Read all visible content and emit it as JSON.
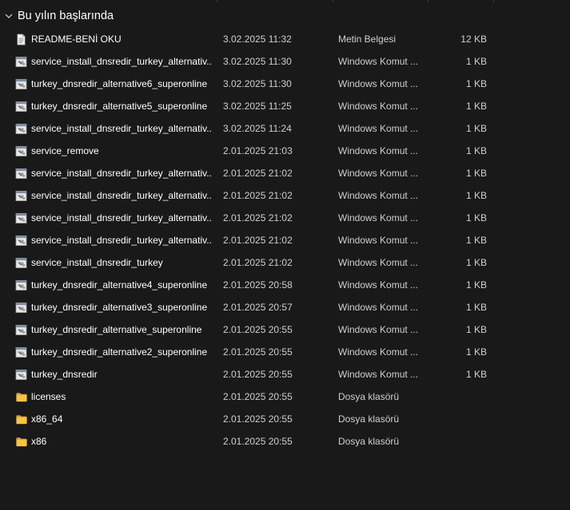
{
  "group": {
    "title": "Bu yılın başlarında"
  },
  "files": [
    {
      "name": "README-BENİ OKU",
      "date": "3.02.2025 11:32",
      "type": "Metin Belgesi",
      "size": "12 KB",
      "icon": "text-document-icon"
    },
    {
      "name": "service_install_dnsredir_turkey_alternativ...",
      "date": "3.02.2025 11:30",
      "type": "Windows Komut ...",
      "size": "1 KB",
      "icon": "batch-file-icon"
    },
    {
      "name": "turkey_dnsredir_alternative6_superonline",
      "date": "3.02.2025 11:30",
      "type": "Windows Komut ...",
      "size": "1 KB",
      "icon": "batch-file-icon"
    },
    {
      "name": "turkey_dnsredir_alternative5_superonline",
      "date": "3.02.2025 11:25",
      "type": "Windows Komut ...",
      "size": "1 KB",
      "icon": "batch-file-icon"
    },
    {
      "name": "service_install_dnsredir_turkey_alternativ...",
      "date": "3.02.2025 11:24",
      "type": "Windows Komut ...",
      "size": "1 KB",
      "icon": "batch-file-icon"
    },
    {
      "name": "service_remove",
      "date": "2.01.2025 21:03",
      "type": "Windows Komut ...",
      "size": "1 KB",
      "icon": "batch-file-icon"
    },
    {
      "name": "service_install_dnsredir_turkey_alternativ...",
      "date": "2.01.2025 21:02",
      "type": "Windows Komut ...",
      "size": "1 KB",
      "icon": "batch-file-icon"
    },
    {
      "name": "service_install_dnsredir_turkey_alternativ...",
      "date": "2.01.2025 21:02",
      "type": "Windows Komut ...",
      "size": "1 KB",
      "icon": "batch-file-icon"
    },
    {
      "name": "service_install_dnsredir_turkey_alternativ...",
      "date": "2.01.2025 21:02",
      "type": "Windows Komut ...",
      "size": "1 KB",
      "icon": "batch-file-icon"
    },
    {
      "name": "service_install_dnsredir_turkey_alternativ...",
      "date": "2.01.2025 21:02",
      "type": "Windows Komut ...",
      "size": "1 KB",
      "icon": "batch-file-icon"
    },
    {
      "name": "service_install_dnsredir_turkey",
      "date": "2.01.2025 21:02",
      "type": "Windows Komut ...",
      "size": "1 KB",
      "icon": "batch-file-icon"
    },
    {
      "name": "turkey_dnsredir_alternative4_superonline",
      "date": "2.01.2025 20:58",
      "type": "Windows Komut ...",
      "size": "1 KB",
      "icon": "batch-file-icon"
    },
    {
      "name": "turkey_dnsredir_alternative3_superonline",
      "date": "2.01.2025 20:57",
      "type": "Windows Komut ...",
      "size": "1 KB",
      "icon": "batch-file-icon"
    },
    {
      "name": "turkey_dnsredir_alternative_superonline",
      "date": "2.01.2025 20:55",
      "type": "Windows Komut ...",
      "size": "1 KB",
      "icon": "batch-file-icon"
    },
    {
      "name": "turkey_dnsredir_alternative2_superonline",
      "date": "2.01.2025 20:55",
      "type": "Windows Komut ...",
      "size": "1 KB",
      "icon": "batch-file-icon"
    },
    {
      "name": "turkey_dnsredir",
      "date": "2.01.2025 20:55",
      "type": "Windows Komut ...",
      "size": "1 KB",
      "icon": "batch-file-icon"
    },
    {
      "name": "licenses",
      "date": "2.01.2025 20:55",
      "type": "Dosya klasörü",
      "size": "",
      "icon": "folder-icon"
    },
    {
      "name": "x86_64",
      "date": "2.01.2025 20:55",
      "type": "Dosya klasörü",
      "size": "",
      "icon": "folder-icon"
    },
    {
      "name": "x86",
      "date": "2.01.2025 20:55",
      "type": "Dosya klasörü",
      "size": "",
      "icon": "folder-icon"
    }
  ],
  "colors": {
    "background": "#191919",
    "folder": "#f4c542",
    "text_primary": "#ffffff",
    "text_secondary": "#cfcfcf"
  }
}
